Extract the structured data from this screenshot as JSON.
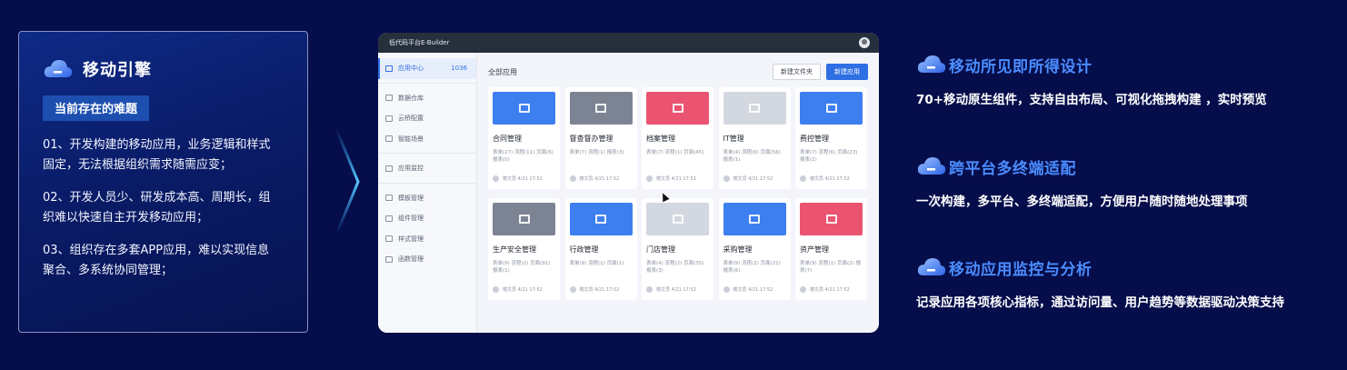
{
  "left_panel": {
    "title": "移动引擎",
    "tag": "当前存在的难题",
    "problems": [
      "01、开发构建的移动应用，业务逻辑和样式固定，无法根据组织需求随需应变；",
      "02、开发人员少、研发成本高、周期长，组织难以快速自主开发移动应用；",
      "03、组织存在多套APP应用，难以实现信息聚合、多系统协同管理；"
    ]
  },
  "app": {
    "window_title": "低代码平台E-Builder",
    "sidebar": {
      "items": [
        {
          "label": "应用中心",
          "count": "1036",
          "active": true,
          "icon": "grid-icon"
        },
        {
          "label": "数据仓库",
          "icon": "database-icon"
        },
        {
          "label": "云桥配置",
          "icon": "bridge-icon"
        },
        {
          "label": "智能场景",
          "icon": "scene-icon"
        },
        {
          "label": "应用监控",
          "icon": "monitor-icon"
        },
        {
          "label": "模板管理",
          "icon": "template-icon"
        },
        {
          "label": "组件管理",
          "icon": "component-icon"
        },
        {
          "label": "样式管理",
          "icon": "style-icon"
        },
        {
          "label": "函数管理",
          "icon": "function-icon"
        }
      ]
    },
    "main": {
      "title": "全部应用",
      "new_folder_label": "新建文件夹",
      "new_app_label": "新建应用"
    },
    "cards": [
      {
        "name": "合同管理",
        "stats": "表单(27) 流程(11) 页面(6)报表(0)",
        "color": "#3e7ff0",
        "icon": "stamp-icon",
        "owner": "楼文员 4/21 17:52"
      },
      {
        "name": "督查督办管理",
        "stats": "表单(7) 流程(1) 报表(3)",
        "color": "#7c8494",
        "icon": "dashboard-icon",
        "owner": "楼文员 4/21 17:52"
      },
      {
        "name": "档案管理",
        "stats": "表单(7) 流程(1) 页面(45)",
        "color": "#ea5470",
        "icon": "archive-icon",
        "owner": "楼文员 4/21 17:52"
      },
      {
        "name": "IT管理",
        "stats": "表单(4) 流程(6) 页面(56) 报表(1)",
        "color": "#d3d7df",
        "icon": "it-icon",
        "owner": "楼文员 4/21 17:52"
      },
      {
        "name": "费控管理",
        "stats": "表单(7) 流程(6) 页面(23) 报表(1)",
        "color": "#3e7ff0",
        "icon": "expense-icon",
        "owner": "楼文员 4/21 17:52"
      },
      {
        "name": "生产安全管理",
        "stats": "表单(9) 流程(2) 页面(91) 报表(1)",
        "color": "#7c8494",
        "icon": "chart-icon",
        "owner": "楼文员 4/21 17:52"
      },
      {
        "name": "行政管理",
        "stats": "表单(9) 流程(1) 页面(1)",
        "color": "#3e7ff0",
        "icon": "bank-icon",
        "owner": "楼文员 4/21 17:52"
      },
      {
        "name": "门店管理",
        "stats": "表单(4) 流程(2) 页面(35) 报表(3)",
        "color": "#d3d7df",
        "icon": "store-icon",
        "owner": "楼文员 4/21 17:52"
      },
      {
        "name": "采购管理",
        "stats": "表单(9) 流程(2) 页面(21) 报表(6)",
        "color": "#3e7ff0",
        "icon": "cart-icon",
        "owner": "楼文员 4/21 17:52"
      },
      {
        "name": "资产管理",
        "stats": "表单(9) 流程(1) 页面(2) 报表(7)",
        "color": "#ea5470",
        "icon": "asset-icon",
        "owner": "楼文员 4/21 17:52"
      }
    ]
  },
  "features": [
    {
      "title": "移动所见即所得设计",
      "desc": "70+移动原生组件，支持自由布局、可视化拖拽构建 ，实时预览"
    },
    {
      "title": "跨平台多终端适配",
      "desc": "一次构建，多平台、多终端适配，方便用户随时随地处理事项"
    },
    {
      "title": "移动应用监控与分析",
      "desc": "记录应用各项核心指标，通过访问量、用户趋势等数据驱动决策支持"
    }
  ],
  "colors": {
    "background": "#050d4a",
    "accent": "#4b8cff",
    "primary_button": "#2f6fe4"
  }
}
